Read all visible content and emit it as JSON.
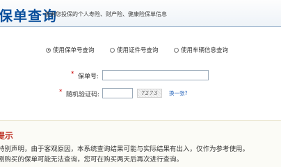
{
  "header": {
    "title": "保单查询",
    "subtitle": "查询您投保的个人寿险、财产险、健康险保单信息"
  },
  "query_types": [
    {
      "label": "使用保单号查询",
      "checked": true
    },
    {
      "label": "使用证件号查询",
      "checked": false
    },
    {
      "label": "使用车辆信息查询",
      "checked": false
    }
  ],
  "form": {
    "required_mark": "*",
    "policy_no": {
      "label": "保单号:",
      "value": "",
      "placeholder": ""
    },
    "captcha": {
      "label": "随机验证码:",
      "value": "",
      "image_text": "7273",
      "refresh_label": "换一张?"
    }
  },
  "notice": {
    "title": "提示",
    "lines": [
      "特别声明，由于客观原因，本系统查询结果可能与实际结果有出入，仅作为参考使用。",
      "刚购买的保单可能无法查询，您可在购买两天后再次进行查询。"
    ]
  },
  "colors": {
    "title_blue": "#0a4f9c",
    "required_red": "#cc0000",
    "link_blue": "#1f5fb8",
    "notice_red": "#c0372b"
  }
}
